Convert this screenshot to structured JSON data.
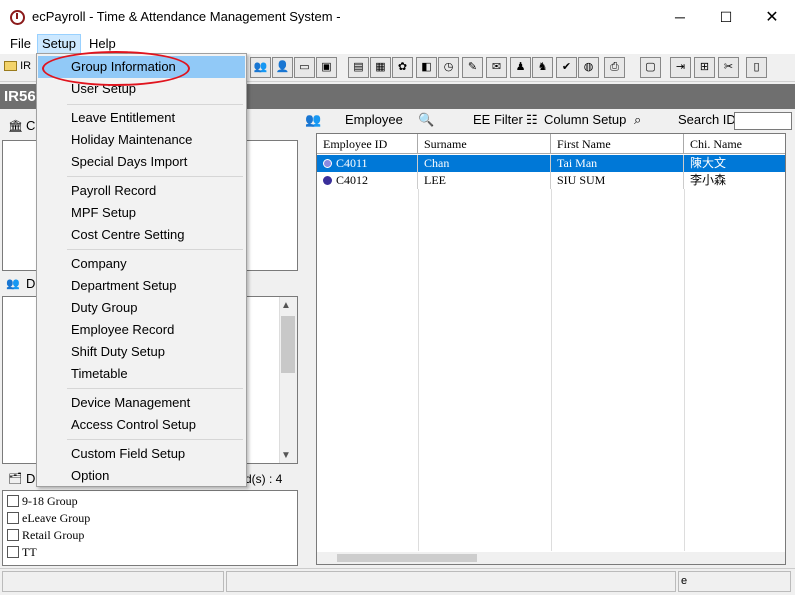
{
  "window": {
    "title": "ecPayroll - Time & Attendance Management System -",
    "minimize": "─",
    "maximize": "☐",
    "close": "✕"
  },
  "menubar": {
    "file": "File",
    "setup": "Setup",
    "help": "Help"
  },
  "toolbar": {
    "folder_label": "IR",
    "icons": [
      "group-icon",
      "person-icon",
      "folder-icon",
      "save-icon",
      "doc-icon",
      "calendar-icon",
      "gear-icon",
      "door-icon",
      "clock-icon",
      "edit-icon",
      "mail-icon",
      "person-run-icon",
      "run-icon",
      "check-icon",
      "globe-icon",
      "print-icon",
      "monitor-icon",
      "export-icon",
      "tree-icon",
      "tools-icon",
      "doc2-icon"
    ]
  },
  "band": {
    "title": "IR56"
  },
  "left_panel": {
    "top_header": "C",
    "middle_header": "D",
    "bottom_header": "D",
    "record_count": "d(s) : 4",
    "groups": [
      "9-18 Group",
      "eLeave Group",
      "Retail Group",
      "TT"
    ]
  },
  "right_panel": {
    "employee_label": "Employee",
    "ee_filter_label": "EE Filter",
    "column_setup_label": "Column Setup",
    "search_id_label": "Search ID",
    "columns": [
      "Employee ID",
      "Surname",
      "First Name",
      "Chi. Name"
    ],
    "rows": [
      {
        "id": "C4011",
        "surname": "Chan",
        "first": "Tai Man",
        "chi": "陳大文",
        "selected": true
      },
      {
        "id": "C4012",
        "surname": "LEE",
        "first": "SIU SUM",
        "chi": "李小森",
        "selected": false
      }
    ]
  },
  "status": {
    "right_text": "e"
  },
  "setup_menu": {
    "items": [
      "Group Information",
      "User Setup",
      "Leave Entitlement",
      "Holiday Maintenance",
      "Special Days Import",
      "Payroll Record",
      "MPF Setup",
      "Cost Centre Setting",
      "Company",
      "Department Setup",
      "Duty Group",
      "Employee Record",
      "Shift Duty Setup",
      "Timetable",
      "Device Management",
      "Access Control Setup",
      "Custom Field Setup",
      "Option"
    ],
    "highlight_color": "#91c9f7",
    "annotation_color": "#e0141e"
  }
}
